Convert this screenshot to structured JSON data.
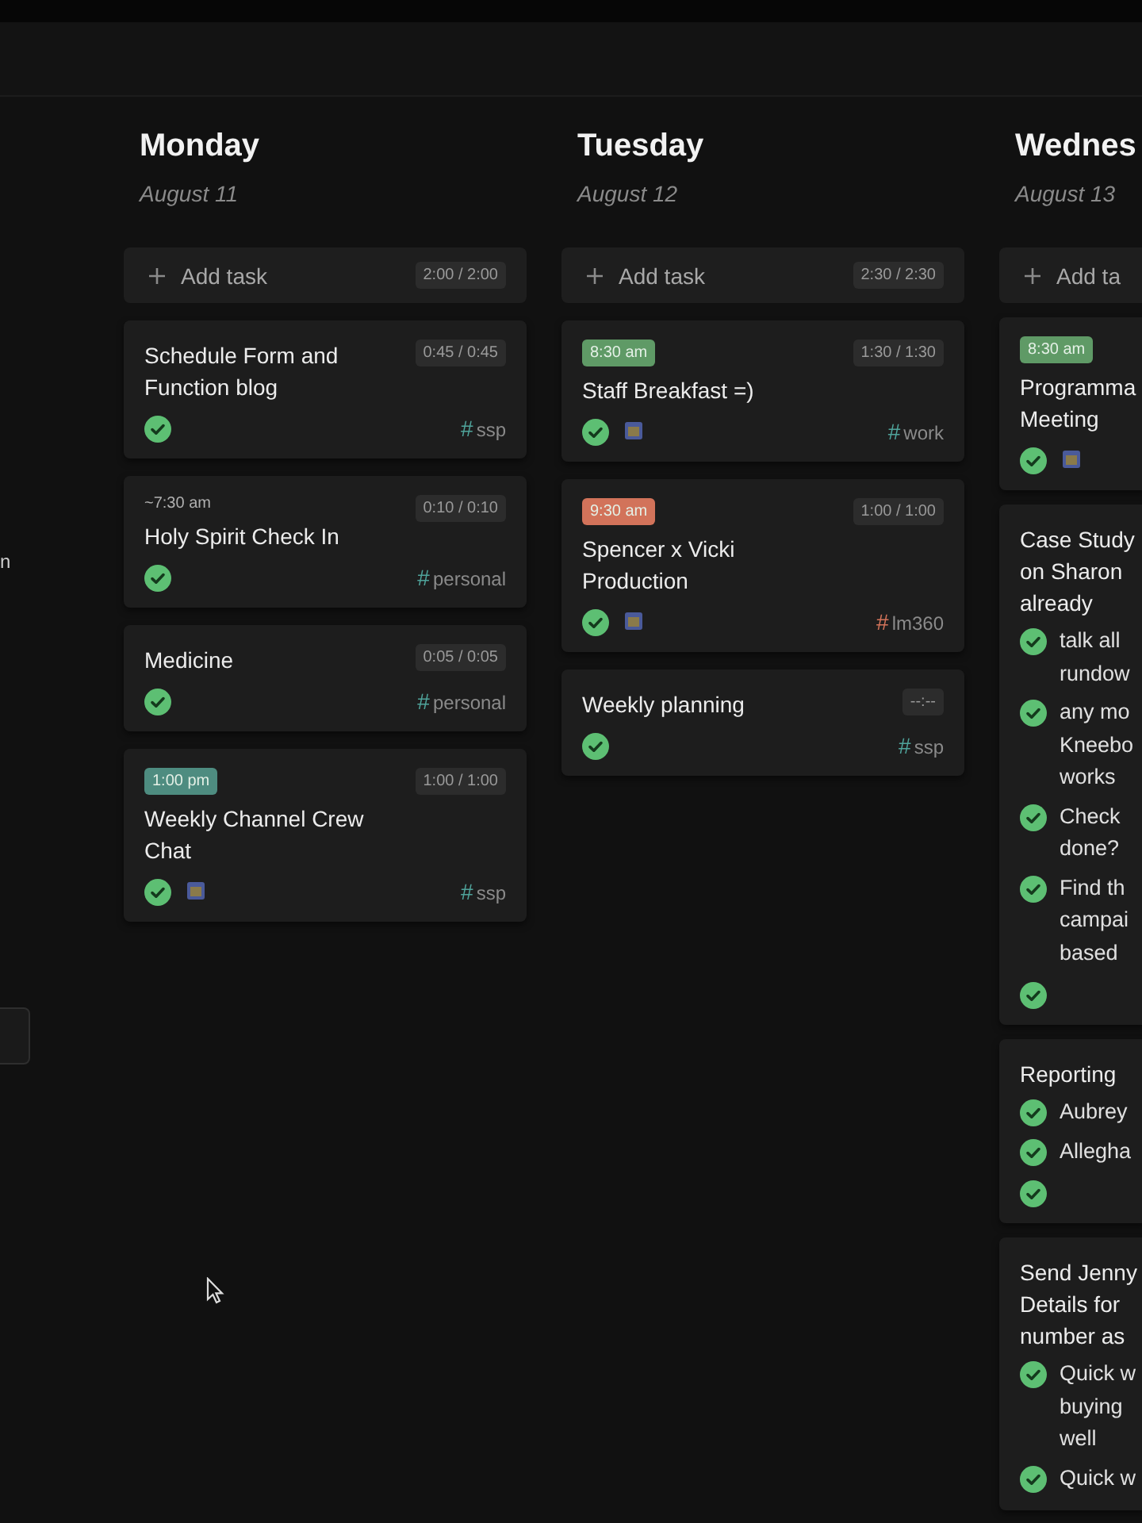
{
  "sidebar": {
    "label": "n"
  },
  "days": [
    {
      "name": "Monday",
      "date": "August 11",
      "add_label": "Add task",
      "total": "2:00 / 2:00",
      "tasks": [
        {
          "title": "Schedule Form and Function blog",
          "duration": "0:45 / 0:45",
          "done": true,
          "calendar": false,
          "tag": {
            "hash": "#",
            "name": "ssp",
            "color": "#4fa39a"
          }
        },
        {
          "time": {
            "text": "~7:30 am",
            "kind": "plain"
          },
          "title": "Holy Spirit Check In",
          "duration": "0:10 / 0:10",
          "done": true,
          "calendar": false,
          "tag": {
            "hash": "#",
            "name": "personal",
            "color": "#4fa39a"
          }
        },
        {
          "title": "Medicine",
          "duration": "0:05 / 0:05",
          "done": true,
          "calendar": false,
          "tag": {
            "hash": "#",
            "name": "personal",
            "color": "#4fa39a"
          }
        },
        {
          "time": {
            "text": "1:00 pm",
            "kind": "badge",
            "color": "#4e8c80"
          },
          "title": "Weekly Channel Crew Chat",
          "duration": "1:00 / 1:00",
          "done": true,
          "calendar": true,
          "tag": {
            "hash": "#",
            "name": "ssp",
            "color": "#4fa39a"
          }
        }
      ]
    },
    {
      "name": "Tuesday",
      "date": "August 12",
      "add_label": "Add task",
      "total": "2:30 / 2:30",
      "tasks": [
        {
          "time": {
            "text": "8:30 am",
            "kind": "badge",
            "color": "#5f9a66"
          },
          "title": "Staff Breakfast =)",
          "duration": "1:30 / 1:30",
          "done": true,
          "calendar": true,
          "tag": {
            "hash": "#",
            "name": "work",
            "color": "#4fa39a"
          }
        },
        {
          "time": {
            "text": "9:30 am",
            "kind": "badge",
            "color": "#d2735a"
          },
          "title": "Spencer x Vicki Production",
          "duration": "1:00 / 1:00",
          "done": true,
          "calendar": true,
          "tag": {
            "hash": "#",
            "name": "lm360",
            "color": "#d2735a"
          }
        },
        {
          "title": "Weekly planning",
          "duration": "--:--",
          "done": true,
          "calendar": false,
          "tag": {
            "hash": "#",
            "name": "ssp",
            "color": "#4fa39a"
          }
        }
      ]
    },
    {
      "name": "Wednes",
      "date": "August 13",
      "add_label": "Add ta",
      "cut": true,
      "tasks": [
        {
          "time": {
            "text": "8:30 am",
            "kind": "badge",
            "color": "#5f9a66"
          },
          "title": "Programma\nMeeting",
          "done": true,
          "calendar": true
        },
        {
          "title": "Case Study\non Sharon\nalready",
          "done": true,
          "calendar": false,
          "subtasks": [
            {
              "text": "talk all\nrundow",
              "done": true
            },
            {
              "text": "any mo\nKneebo\nworks",
              "done": true
            },
            {
              "text": "Check\ndone?",
              "done": true
            },
            {
              "text": "Find th\ncampai\nbased",
              "done": true
            }
          ]
        },
        {
          "title": "Reporting",
          "done": true,
          "calendar": false,
          "subtasks": [
            {
              "text": "Aubrey",
              "done": true
            },
            {
              "text": "Allegha",
              "done": true
            }
          ]
        },
        {
          "title": "Send Jenny\nDetails for\nnumber as",
          "subtasks": [
            {
              "text": "Quick w\nbuying\nwell",
              "done": true
            },
            {
              "text": "Quick w",
              "done": true
            }
          ]
        }
      ]
    }
  ]
}
